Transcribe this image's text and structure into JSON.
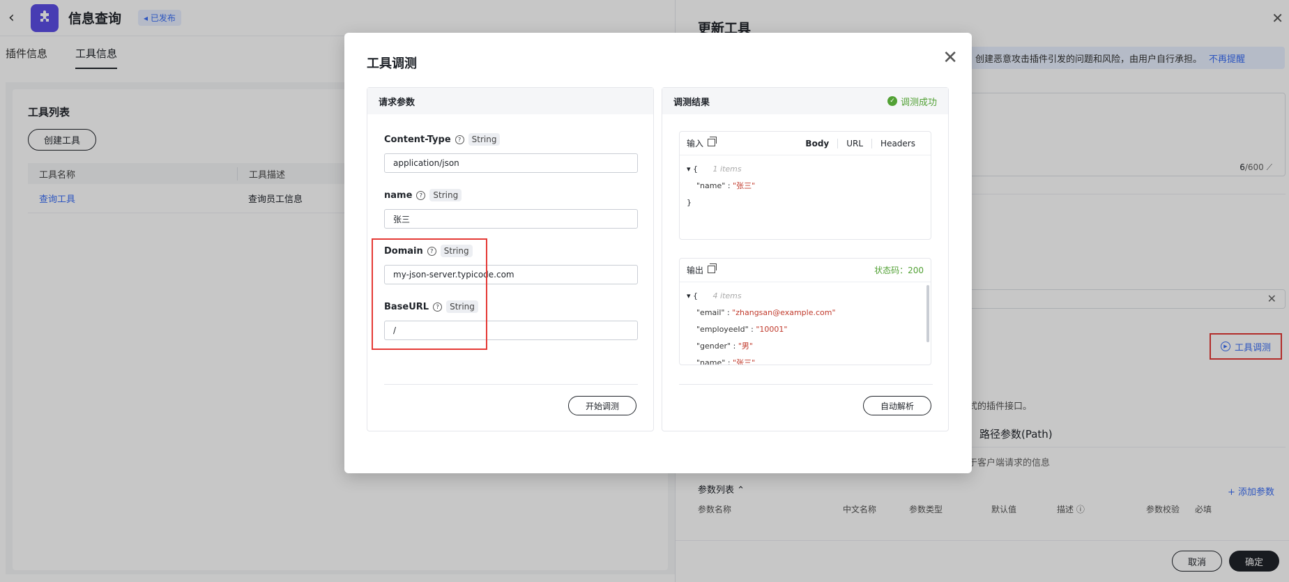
{
  "header": {
    "back_icon": "chevron-left-icon",
    "app_icon": "puzzle-icon",
    "title": "信息查询",
    "status_badge": "已发布"
  },
  "subtabs": [
    "插件信息",
    "工具信息"
  ],
  "tool_list": {
    "title": "工具列表",
    "create_button": "创建工具",
    "columns": [
      "工具名称",
      "工具描述"
    ],
    "rows": [
      {
        "name": "查询工具",
        "desc": "查询员工信息"
      }
    ]
  },
  "drawer": {
    "title": "更新工具",
    "notice": "创建恶意攻击插件引发的问题和风险，由用户自行承担。",
    "notice_link": "不再提醒",
    "counter_value": "6",
    "counter_max": "/600",
    "test_button": "工具调测",
    "hint": "式的插件接口。",
    "path_tab": "路径参数(Path)",
    "hint2": "于客户端请求的信息",
    "param_list_label": "参数列表 ⌃",
    "add_param": "+ 添加参数",
    "param_headers": [
      "参数名称",
      "中文名称",
      "参数类型",
      "默认值",
      "描述 ⓘ",
      "参数校验",
      "必填"
    ],
    "cancel": "取消",
    "confirm": "确定"
  },
  "modal": {
    "title": "工具调测",
    "left_panel": {
      "title": "请求参数",
      "fields": [
        {
          "label": "Content-Type",
          "type": "String",
          "value": "application/json"
        },
        {
          "label": "name",
          "type": "String",
          "value": "张三"
        },
        {
          "label": "Domain",
          "type": "String",
          "value": "my-json-server.typicode.com"
        },
        {
          "label": "BaseURL",
          "type": "String",
          "value": "/"
        }
      ],
      "start_button": "开始调测"
    },
    "right_panel": {
      "title": "调测结果",
      "status": "调测成功",
      "input": {
        "label": "输入",
        "tabs": [
          "Body",
          "URL",
          "Headers"
        ],
        "items_hint": "1 items",
        "lines": [
          {
            "key": "\"name\"",
            "value": "\"张三\""
          }
        ]
      },
      "output": {
        "label": "输出",
        "status_code": "状态码：200",
        "items_hint": "4 items",
        "lines": [
          {
            "key": "\"email\"",
            "value": "\"zhangsan@example.com\""
          },
          {
            "key": "\"employeeId\"",
            "value": "\"10001\""
          },
          {
            "key": "\"gender\"",
            "value": "\"男\""
          },
          {
            "key": "\"name\"",
            "value": "\"张三\""
          }
        ]
      },
      "parse_button": "自动解析"
    }
  },
  "colors": {
    "accent": "#3a6ef5",
    "success": "#52a135",
    "highlight": "#e53935"
  }
}
